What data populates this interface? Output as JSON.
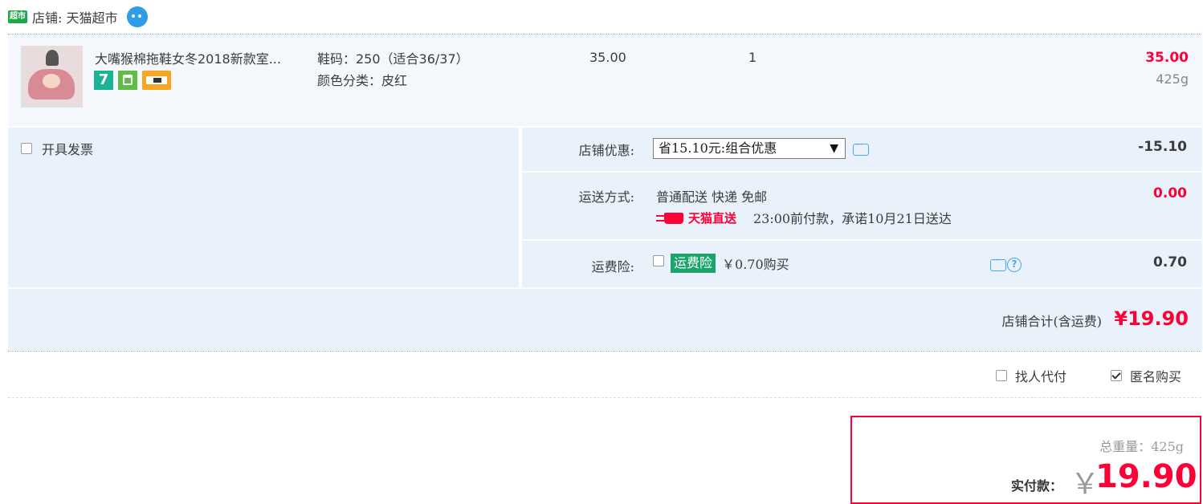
{
  "shop": {
    "badge": "超市",
    "label": "店铺: 天猫超市"
  },
  "item": {
    "title": "大嘴猴棉拖鞋女冬2018新款室...",
    "sku_size": "鞋码：250（适合36/37）",
    "sku_color": "颜色分类：皮红",
    "price": "35.00",
    "quantity": "1",
    "subtotal": "35.00",
    "weight": "425g",
    "service_icon_7": "7"
  },
  "invoice": {
    "label": "开具发票"
  },
  "discount": {
    "label": "店铺优惠:",
    "selected": "省15.10元:组合优惠",
    "amount": "-15.10"
  },
  "shipping": {
    "label": "运送方式:",
    "method": "普通配送 快递 免邮",
    "brand": "天猫直送",
    "promise": "23:00前付款，承诺10月21日送达",
    "amount": "0.00"
  },
  "insurance": {
    "label": "运费险:",
    "badge": "运费险",
    "price": "￥0.70购买",
    "amount": "0.70"
  },
  "shop_total": {
    "label": "店铺合计(含运费)",
    "value": "¥19.90"
  },
  "options": {
    "proxy_pay": "找人代付",
    "anonymous": "匿名购买"
  },
  "payment": {
    "weight": "总重量：425g",
    "label": "实付款：",
    "currency": "￥",
    "value": "19.90"
  },
  "colors": {
    "accent": "#ff0036",
    "panel": "#e9f1fb",
    "link": "#4ea7e6",
    "green": "#1aa36b"
  }
}
